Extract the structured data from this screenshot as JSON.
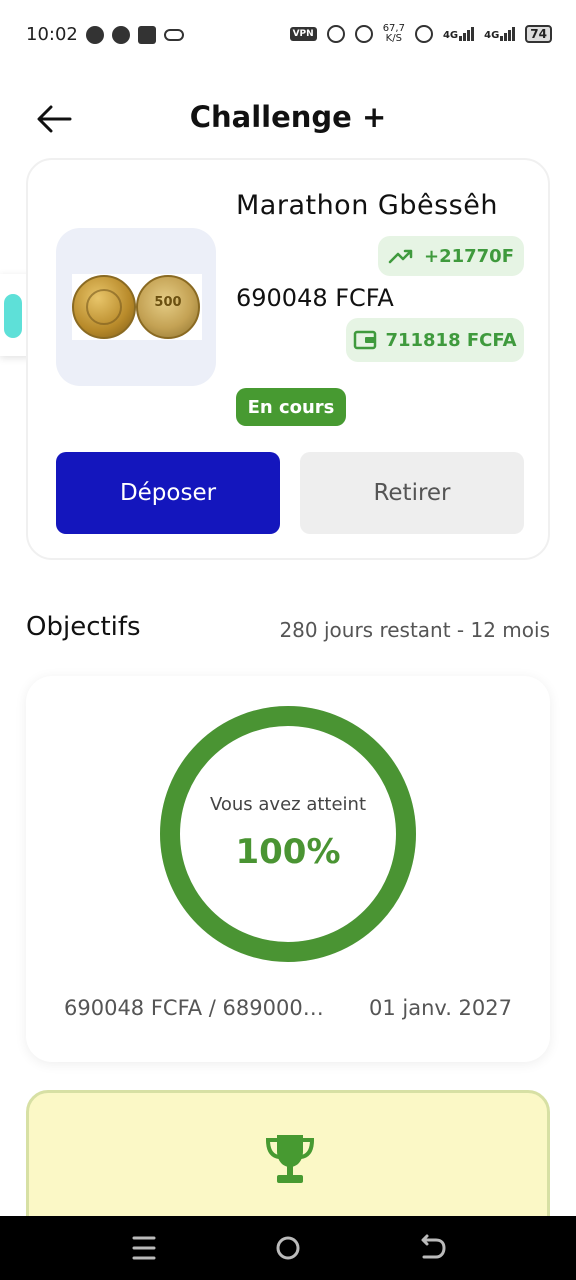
{
  "status_bar": {
    "time": "10:02",
    "vpn": "VPN",
    "speed_value": "67,7",
    "speed_unit": "K/S",
    "network_1": "4G",
    "network_2": "4G",
    "battery": "74"
  },
  "header": {
    "title": "Challenge +"
  },
  "challenge": {
    "name": "Marathon Gbêssêh",
    "growth": "+21770F",
    "balance": "690048 FCFA",
    "wallet": "711818 FCFA",
    "status": "En cours",
    "coin_value": "500",
    "deposit_label": "Déposer",
    "withdraw_label": "Retirer"
  },
  "objectives": {
    "title": "Objectifs",
    "remaining": "280 jours restant - 12 mois",
    "caption": "Vous avez atteint",
    "percent_label": "100%",
    "progress": 1.0,
    "amounts": "690048 FCFA / 689000…",
    "target_date": "01 janv. 2027"
  },
  "colors": {
    "accent_green": "#4a9433",
    "primary_blue": "#1416bd",
    "badge_bg": "#e6f4e4",
    "reward_bg": "#fbf8c6"
  },
  "icons": {
    "back": "arrow-left-icon",
    "growth": "trending-up-icon",
    "wallet": "wallet-icon",
    "reward": "trophy-icon"
  }
}
